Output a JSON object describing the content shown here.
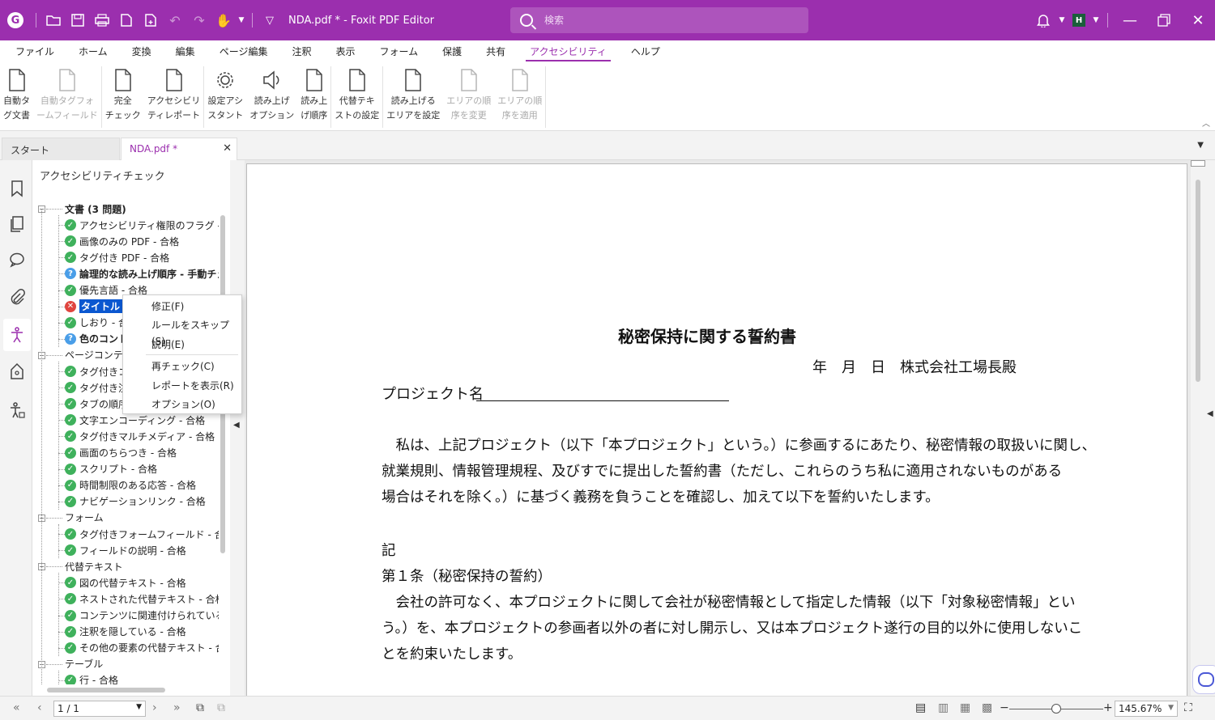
{
  "titlebar": {
    "title": "NDA.pdf * - Foxit PDF Editor",
    "search_placeholder": "検索",
    "avatar_initial": "H",
    "accent_color": "#9b2fae"
  },
  "menu": [
    "ファイル",
    "ホーム",
    "変換",
    "編集",
    "ページ編集",
    "注釈",
    "表示",
    "フォーム",
    "保護",
    "共有",
    "アクセシビリティ",
    "ヘルプ"
  ],
  "active_menu": "アクセシビリティ",
  "ribbon": {
    "groups": [
      [
        {
          "label": "自動タ\nグ文書",
          "icon": "auto-tag-icon",
          "enabled": true
        },
        {
          "label": "自動タグフォ\nームフィールド",
          "icon": "auto-tag-form-icon",
          "enabled": false
        }
      ],
      [
        {
          "label": "完全\nチェック",
          "icon": "full-check-icon",
          "enabled": true
        },
        {
          "label": "アクセシビリ\nティレポート",
          "icon": "accessibility-report-icon",
          "enabled": true
        }
      ],
      [
        {
          "label": "設定アシ\nスタント",
          "icon": "setup-assistant-icon",
          "enabled": true
        },
        {
          "label": "読み上げ\nオプション",
          "icon": "read-aloud-options-icon",
          "enabled": true
        },
        {
          "label": "読み上\nげ順序",
          "icon": "reading-order-icon",
          "enabled": true
        }
      ],
      [
        {
          "label": "代替テキ\nストの設定",
          "icon": "alt-text-icon",
          "enabled": true
        }
      ],
      [
        {
          "label": "読み上げる\nエリアを設定",
          "icon": "read-area-icon",
          "enabled": true
        },
        {
          "label": "エリアの順\n序を変更",
          "icon": "change-area-order-icon",
          "enabled": false
        },
        {
          "label": "エリアの順\n序を適用",
          "icon": "apply-area-order-icon",
          "enabled": false
        }
      ]
    ]
  },
  "tabs": {
    "start": "スタート",
    "doc": "NDA.pdf *"
  },
  "panel": {
    "title": "アクセシビリティチェック",
    "tree": [
      {
        "label": "文書 (3 問題)",
        "level": 0,
        "status": "",
        "bold": true,
        "toggle": "⊟"
      },
      {
        "label": "アクセシビリティ権限のフラグ - 合格",
        "level": 1,
        "status": "pass"
      },
      {
        "label": "画像のみの PDF - 合格",
        "level": 1,
        "status": "pass"
      },
      {
        "label": "タグ付き PDF - 合格",
        "level": 1,
        "status": "pass"
      },
      {
        "label": "論理的な読み上げ順序 - 手動チェックが必要",
        "level": 1,
        "status": "manual",
        "bold": true
      },
      {
        "label": "優先言語 - 合格",
        "level": 1,
        "status": "pass"
      },
      {
        "label": "タイトル - 不合格",
        "level": 1,
        "status": "fail",
        "bold": true,
        "selected": true
      },
      {
        "label": "しおり - 合格",
        "level": 1,
        "status": "pass"
      },
      {
        "label": "色のコントラスト - 手動チェックが必要",
        "level": 1,
        "status": "manual",
        "bold": true
      },
      {
        "label": "ページコンテンツ",
        "level": 0,
        "status": "",
        "toggle": "⊟"
      },
      {
        "label": "タグ付きコンテンツ - 合格",
        "level": 1,
        "status": "pass"
      },
      {
        "label": "タグ付き注釈 - 合格",
        "level": 1,
        "status": "pass"
      },
      {
        "label": "タブの順序 - 合格",
        "level": 1,
        "status": "pass"
      },
      {
        "label": "文字エンコーディング - 合格",
        "level": 1,
        "status": "pass"
      },
      {
        "label": "タグ付きマルチメディア - 合格",
        "level": 1,
        "status": "pass"
      },
      {
        "label": "画面のちらつき - 合格",
        "level": 1,
        "status": "pass"
      },
      {
        "label": "スクリプト - 合格",
        "level": 1,
        "status": "pass"
      },
      {
        "label": "時間制限のある応答 - 合格",
        "level": 1,
        "status": "pass"
      },
      {
        "label": "ナビゲーションリンク - 合格",
        "level": 1,
        "status": "pass"
      },
      {
        "label": "フォーム",
        "level": 0,
        "status": "",
        "toggle": "⊟"
      },
      {
        "label": "タグ付きフォームフィールド - 合格",
        "level": 1,
        "status": "pass"
      },
      {
        "label": "フィールドの説明 - 合格",
        "level": 1,
        "status": "pass"
      },
      {
        "label": "代替テキスト",
        "level": 0,
        "status": "",
        "toggle": "⊟"
      },
      {
        "label": "図の代替テキスト - 合格",
        "level": 1,
        "status": "pass"
      },
      {
        "label": "ネストされた代替テキスト - 合格",
        "level": 1,
        "status": "pass"
      },
      {
        "label": "コンテンツに関連付けられている - 合格",
        "level": 1,
        "status": "pass"
      },
      {
        "label": "注釈を隠している - 合格",
        "level": 1,
        "status": "pass"
      },
      {
        "label": "その他の要素の代替テキスト - 合格",
        "level": 1,
        "status": "pass"
      },
      {
        "label": "テーブル",
        "level": 0,
        "status": "",
        "toggle": "⊟"
      },
      {
        "label": "行 - 合格",
        "level": 1,
        "status": "pass"
      }
    ]
  },
  "context_menu": [
    {
      "label": "修正(F)"
    },
    {
      "label": "ルールをスキップ(S)"
    },
    {
      "label": "説明(E)"
    },
    {
      "label": "再チェック(C)"
    },
    {
      "label": "レポートを表示(R)"
    },
    {
      "label": "オプション(O)"
    }
  ],
  "document": {
    "title": "秘密保持に関する誓約書",
    "date_line": "年　月　日　株式会社工場長殿",
    "project_label": "プロジェクト名",
    "para1": [
      "　私は、上記プロジェクト（以下「本プロジェクト」という。）に参画するにあたり、秘密情報の取扱いに関し、",
      "就業規則、情報管理規程、及びすでに提出した誓約書（ただし、これらのうち私に適用されないものがある",
      "場合はそれを除く。）に基づく義務を負うことを確認し、加えて以下を誓約いたします。"
    ],
    "ki": "記",
    "article1": "第１条（秘密保持の誓約）",
    "para2": [
      "　会社の許可なく、本プロジェクトに関して会社が秘密情報として指定した情報（以下「対象秘密情報」とい",
      "う。）を、本プロジェクトの参画者以外の者に対し開示し、又は本プロジェクト遂行の目的以外に使用しないこ",
      "とを約束いたします。"
    ]
  },
  "statusbar": {
    "page": "1 / 1",
    "zoom": "145.67%",
    "zoom_level": 0.5
  }
}
